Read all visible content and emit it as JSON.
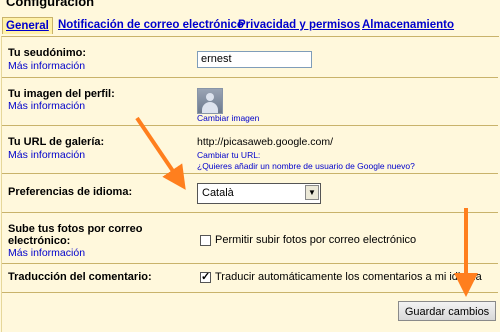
{
  "title": "Configuración",
  "tabs": [
    {
      "label": "General",
      "active": true
    },
    {
      "label": "Notificación de correo electrónico"
    },
    {
      "label": "Privacidad y permisos"
    },
    {
      "label": "Almacenamiento"
    }
  ],
  "more_info": "Más información",
  "nickname": {
    "label": "Tu seudónimo:",
    "value": "ernest"
  },
  "profile_image": {
    "label": "Tu imagen del perfil:",
    "change_link": "Cambiar imagen"
  },
  "gallery_url": {
    "label": "Tu URL de galería:",
    "url": "http://picasaweb.google.com/",
    "change_link": "Cambiar tu URL:",
    "question_link": "¿Quieres añadir un nombre de usuario de Google nuevo?"
  },
  "language": {
    "label": "Preferencias de idioma:",
    "selected": "Català"
  },
  "upload": {
    "label_line1": "Sube tus fotos por correo",
    "label_line2": "electrónico:",
    "checkbox_label": "Permitir subir fotos por correo electrónico",
    "checked": false
  },
  "translation": {
    "label": "Traducción del comentario:",
    "checkbox_label": "Traducir automáticamente los comentarios a mi idioma",
    "checked": true
  },
  "save_button": "Guardar cambios",
  "colors": {
    "background": "#fff8dc",
    "link": "#0000cc",
    "arrow": "#ff7f1e"
  },
  "icons": {
    "profile": "avatar-placeholder-icon",
    "dropdown": "chevron-down-icon"
  }
}
